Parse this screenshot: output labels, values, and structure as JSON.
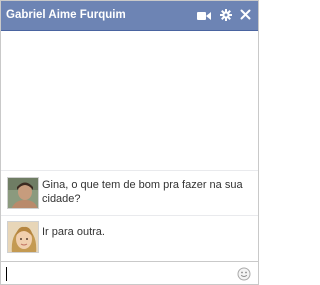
{
  "window": {
    "title": "Gabriel Aime Furquim"
  },
  "toolbar": {
    "icons": [
      "video-icon",
      "gear-icon",
      "close-icon"
    ]
  },
  "messages": [
    {
      "sender_avatar": "avatar-male",
      "text": "Gina, o que tem de bom pra fazer na sua cidade?"
    },
    {
      "sender_avatar": "avatar-female",
      "text": "Ir para outra."
    }
  ],
  "composer": {
    "value": "",
    "emoticon_icon": "smiley-icon"
  },
  "colors": {
    "titlebar": "#6d84b4",
    "titlebar_text": "#ffffff",
    "message_text": "#333333"
  }
}
